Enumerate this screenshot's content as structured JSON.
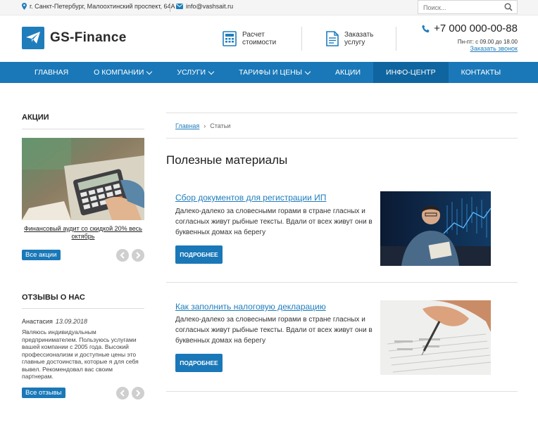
{
  "topbar": {
    "address": "г. Санкт-Петербург, Малоохтинский проспект, 64А",
    "email": "info@vashsait.ru",
    "search_placeholder": "Поиск..."
  },
  "header": {
    "logo_text": "GS-Finance",
    "calc_label_line1": "Расчет",
    "calc_label_line2": "стоимости",
    "order_label_line1": "Заказать",
    "order_label_line2": "услугу",
    "phone": "+7 000 000-00-88",
    "hours": "Пн-пт: с 09.00 до 18.00",
    "callback": "Заказать звонок"
  },
  "nav": {
    "items": [
      {
        "label": "ГЛАВНАЯ"
      },
      {
        "label": "О КОМПАНИИ"
      },
      {
        "label": "УСЛУГИ"
      },
      {
        "label": "ТАРИФЫ И ЦЕНЫ"
      },
      {
        "label": "АКЦИИ"
      },
      {
        "label": "ИНФО-ЦЕНТР"
      },
      {
        "label": "КОНТАКТЫ"
      }
    ]
  },
  "sidebar": {
    "promos_title": "АКЦИИ",
    "promo_caption": "Финансовый аудит со скидкой 20% весь октябрь",
    "all_promos": "Все акции",
    "reviews_title": "ОТЗЫВЫ О НАС",
    "review_author": "Анастасия",
    "review_date": "13.09.2018",
    "review_text": "Являюсь индивидуальным предпринимателем. Пользуюсь услугами вашей компании с 2005 года. Высокий профессионализм и доступные цены это главные достоинства, которые я для себя вывел. Рекомендовал вас своим партнерам.",
    "all_reviews": "Все отзывы"
  },
  "main": {
    "breadcrumb_home": "Главная",
    "breadcrumb_current": "Статьи",
    "page_title": "Полезные материалы",
    "articles": [
      {
        "title": "Сбор документов для регистрации ИП",
        "text": "Далеко-далеко за словесными горами в стране гласных и согласных живут рыбные тексты. Вдали от всех живут они в буквенных домах на берегу",
        "button": "ПОДРОБНЕЕ"
      },
      {
        "title": "Как заполнить налоговую декларацию",
        "text": "Далеко-далеко за словесными горами в стране гласных и согласных живут рыбные тексты. Вдали от всех живут они в буквенных домах на берегу",
        "button": "ПОДРОБНЕЕ"
      }
    ]
  },
  "colors": {
    "brand_blue": "#1a78b8",
    "nav_active": "#0f659f",
    "link_blue": "#1f7dbc"
  }
}
